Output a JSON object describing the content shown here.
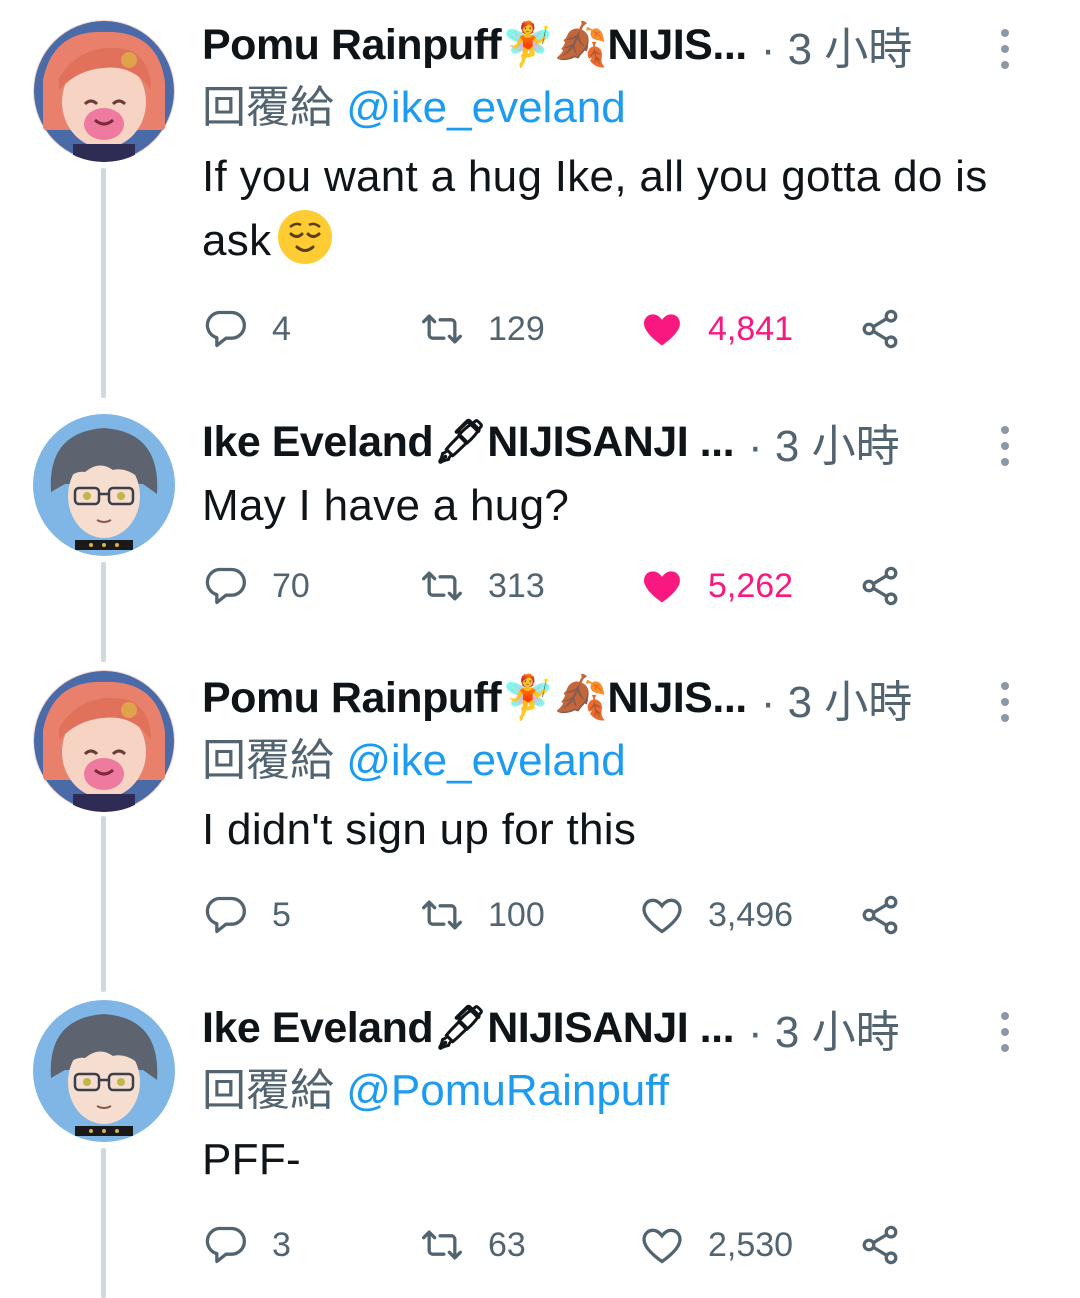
{
  "thread": [
    {
      "author": "Pomu Rainpuff🧚🍂NIJIS...",
      "author_emojis": [
        "fairy-emoji",
        "leaves-emoji"
      ],
      "time": "· 3 小時",
      "reply_prefix": "回覆給",
      "reply_handle": "@ike_eveland",
      "text": "If you want a hug Ike, all you gotta do is ask",
      "text_emoji": "relieved-face-emoji",
      "replies": "4",
      "retweets": "129",
      "likes": "4,841",
      "liked": true
    },
    {
      "author": "Ike Eveland🖋NIJISANJI ...",
      "author_emojis": [
        "fountain-pen-emoji"
      ],
      "time": "· 3 小時",
      "text": "May I have a hug?",
      "replies": "70",
      "retweets": "313",
      "likes": "5,262",
      "liked": true
    },
    {
      "author": "Pomu Rainpuff🧚🍂NIJIS...",
      "author_emojis": [
        "fairy-emoji",
        "leaves-emoji"
      ],
      "time": "· 3 小時",
      "reply_prefix": "回覆給",
      "reply_handle": "@ike_eveland",
      "text": "I didn't sign up for this",
      "replies": "5",
      "retweets": "100",
      "likes": "3,496",
      "liked": false
    },
    {
      "author": "Ike Eveland🖋NIJISANJI ...",
      "author_emojis": [
        "fountain-pen-emoji"
      ],
      "time": "· 3 小時",
      "reply_prefix": "回覆給",
      "reply_handle": "@PomuRainpuff",
      "text": "PFF-",
      "replies": "3",
      "retweets": "63",
      "likes": "2,530",
      "liked": false
    }
  ],
  "colors": {
    "link": "#1d9bf0",
    "muted": "#536471",
    "like_active": "#f91880",
    "thread_line": "#cfd9de"
  },
  "icons": [
    "reply-icon",
    "retweet-icon",
    "heart-icon",
    "share-icon",
    "more-options-icon"
  ]
}
